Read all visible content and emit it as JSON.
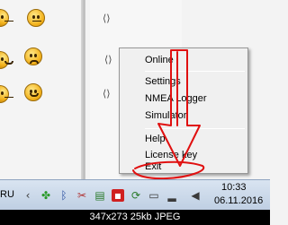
{
  "context_menu": {
    "items": [
      "Online",
      "Settings",
      "NMEA Logger",
      "Simulator",
      "Help",
      "License key",
      "Exit"
    ]
  },
  "taskbar": {
    "language": "RU",
    "time": "10:33",
    "date": "06.11.2016",
    "tray_icons": [
      "nvidia-icon",
      "bluetooth-icon",
      "tools-icon",
      "network-icon",
      "app-tray-icon",
      "sync-icon",
      "monitor-icon",
      "signal-icon",
      "volume-icon"
    ]
  },
  "caption": "347x273 25kb JPEG",
  "colors": {
    "annotation": "#e01010",
    "menu_bg": "#f0f0f0",
    "taskbar": "#c9d7e8"
  }
}
